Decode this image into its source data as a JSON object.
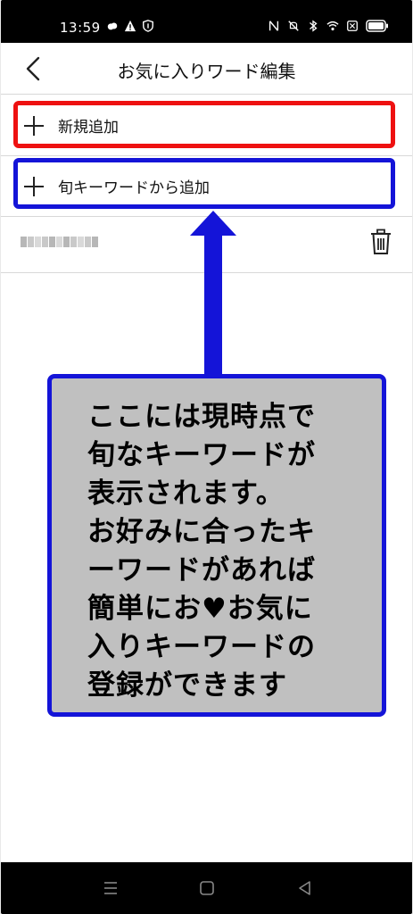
{
  "status_bar": {
    "time": "13:59",
    "left_icons": [
      "weather-icon",
      "warning-icon",
      "shield-icon"
    ],
    "right_icons": [
      "nfc-icon",
      "mute-icon",
      "bluetooth-icon",
      "wifi-icon",
      "sim-icon",
      "battery-icon"
    ]
  },
  "header": {
    "title": "お気に入りワード編集",
    "back_icon": "chevron-left-icon"
  },
  "list": {
    "add_new_label": "新規追加",
    "add_trending_label": "旬キーワードから追加",
    "saved_item_icon": "trash-icon"
  },
  "annotation": {
    "text": "ここには現時点で\n旬なキーワードが\n表示されます。\nお好みに合ったキ\nーワードがあれば\n簡単にお♥お気に\n入りキーワードの\n登録ができます",
    "border_color": "#1414d8",
    "highlight_red": "#ee1111",
    "highlight_blue": "#1414d8"
  },
  "nav_bar": {
    "icons": [
      "menu-icon",
      "home-icon",
      "back-triangle-icon"
    ]
  }
}
